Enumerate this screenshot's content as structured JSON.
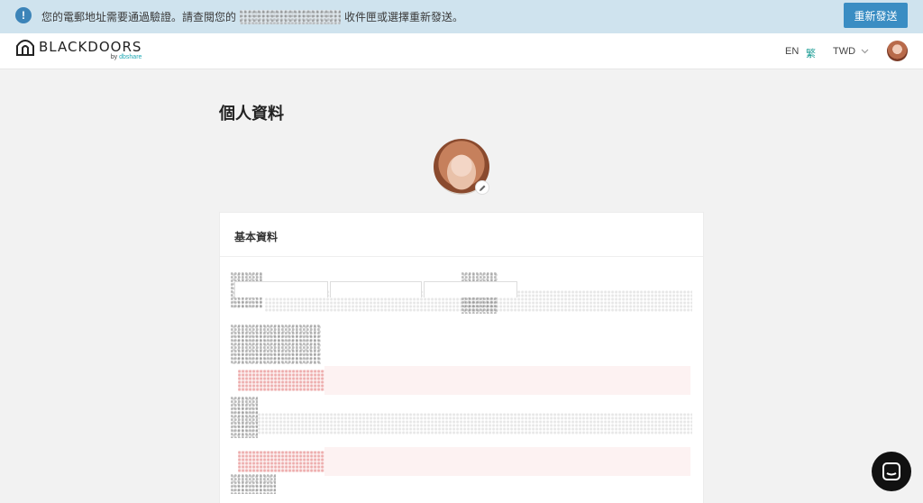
{
  "notice": {
    "icon": "exclamation-icon",
    "text_before": "您的電郵地址需要通過驗證。請查閱您的",
    "text_after": "收件匣或選擇重新發送。",
    "resend_label": "重新發送",
    "accent_color": "#3a8dc3",
    "background_color": "#cfe3ee"
  },
  "header": {
    "logo_name": "BLACKDOORS",
    "logo_by": "by",
    "logo_brand": "dbshare",
    "lang_en": "EN",
    "lang_current": "繁",
    "currency": "TWD",
    "avatar_icon": "user-avatar"
  },
  "page": {
    "title": "個人資料"
  },
  "card": {
    "title": "基本資料"
  },
  "chat": {
    "icon": "chat-bubble-icon"
  }
}
